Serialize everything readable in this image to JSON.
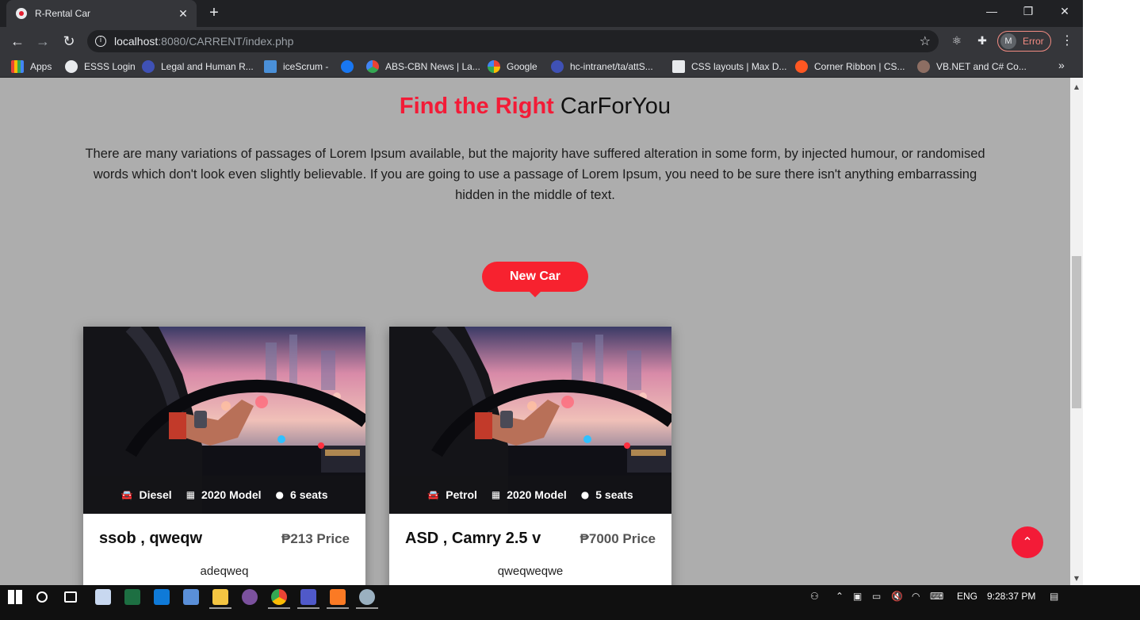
{
  "browser": {
    "tab_title": "R-Rental Car",
    "tab_close": "✕",
    "new_tab": "+",
    "window": {
      "minimize": "—",
      "restore": "❐",
      "close": "✕"
    },
    "nav": {
      "back": "←",
      "forward": "→",
      "reload": "↻"
    },
    "url_host": "localhost",
    "url_rest": ":8080/CARRENT/index.php",
    "profile_initial": "M",
    "profile_status": "Error",
    "bookmarks": [
      {
        "label": "Apps",
        "icon_color": "#ea4335"
      },
      {
        "label": "ESSS Login",
        "icon_color": "#e8eaed"
      },
      {
        "label": "Legal and Human R...",
        "icon_color": "#3f51b5"
      },
      {
        "label": "iceScrum -",
        "icon_color": "#4a90d9"
      },
      {
        "label": "",
        "icon_color": "#1877f2"
      },
      {
        "label": "ABS-CBN News | La...",
        "icon_color": "#34a853"
      },
      {
        "label": "Google",
        "icon_color": "#4285f4"
      },
      {
        "label": "hc-intranet/ta/attS...",
        "icon_color": "#3f51b5"
      },
      {
        "label": "CSS layouts | Max D...",
        "icon_color": "#e8eaed"
      },
      {
        "label": "Corner Ribbon | CS...",
        "icon_color": "#ff5722"
      },
      {
        "label": "VB.NET and C# Co...",
        "icon_color": "#8d6e63"
      }
    ],
    "bookmarks_more": "»"
  },
  "page": {
    "heading_accent": "Find the Right",
    "heading_rest": " CarForYou",
    "intro": "There are many variations of passages of Lorem Ipsum available, but the majority have suffered alteration in some form, by injected humour, or randomised words which don't look even slightly believable. If you are going to use a passage of Lorem Ipsum, you need to be sure there isn't anything embarrassing hidden in the middle of text.",
    "badge": "New Car",
    "accent_color": "#f31b37",
    "cars": [
      {
        "fuel": "Diesel",
        "model": "2020 Model",
        "seats": "6 seats",
        "name": "ssob , qweqw",
        "price": "₱213 Price",
        "desc": "adeqweq"
      },
      {
        "fuel": "Petrol",
        "model": "2020 Model",
        "seats": "5 seats",
        "name": "ASD , Camry 2.5 v",
        "price": "₱7000 Price",
        "desc": "qweqweqwe"
      }
    ],
    "to_top": "⌃"
  },
  "taskbar": {
    "language": "ENG",
    "time": "9:28:37 PM"
  }
}
